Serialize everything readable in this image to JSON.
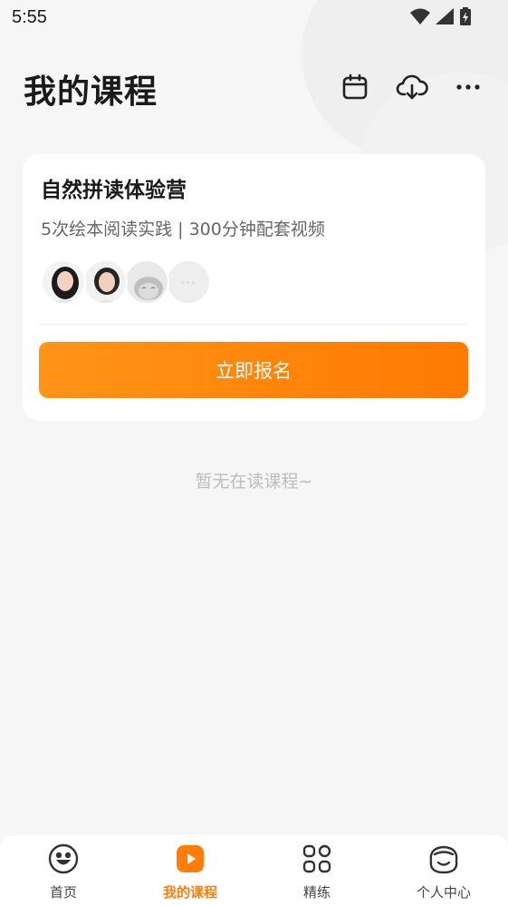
{
  "status_bar": {
    "time": "5:55"
  },
  "header": {
    "title": "我的课程"
  },
  "course_card": {
    "title": "自然拼读体验营",
    "subtitle": "5次绘本阅读实践 | 300分钟配套视频",
    "more_label": "···",
    "enroll_label": "立即报名"
  },
  "empty_state": "暂无在读课程~",
  "tabs": [
    {
      "label": "首页",
      "icon": "home-icon"
    },
    {
      "label": "我的课程",
      "icon": "play-icon",
      "active": true
    },
    {
      "label": "精练",
      "icon": "grid-icon"
    },
    {
      "label": "个人中心",
      "icon": "profile-icon"
    }
  ],
  "colors": {
    "accent": "#ff8000",
    "background": "#f6f6f6",
    "card": "#ffffff"
  }
}
